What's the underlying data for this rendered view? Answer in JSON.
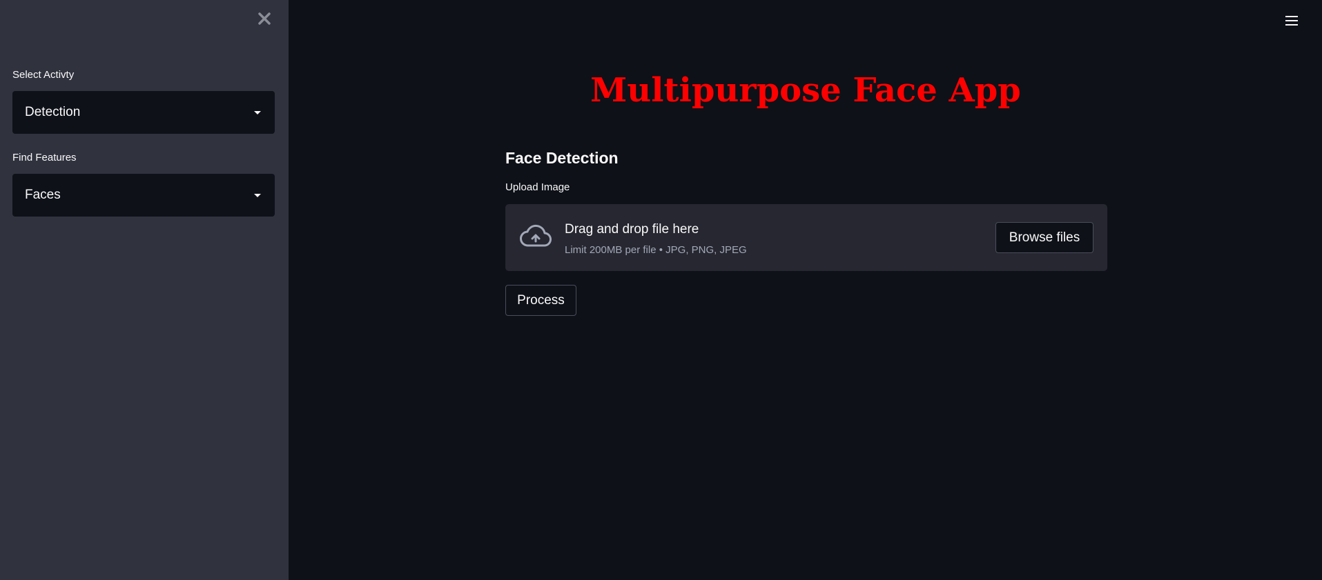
{
  "app": {
    "title": "Multipurpose Face App"
  },
  "sidebar": {
    "close_icon": "close-icon",
    "activity": {
      "label": "Select Activty",
      "value": "Detection"
    },
    "features": {
      "label": "Find Features",
      "value": "Faces"
    }
  },
  "main": {
    "menu_icon": "hamburger-menu-icon",
    "section_title": "Face Detection",
    "uploader": {
      "label": "Upload Image",
      "prompt": "Drag and drop file here",
      "limits": "Limit 200MB per file • JPG, PNG, JPEG",
      "browse_label": "Browse files",
      "icon": "cloud-upload-icon"
    },
    "process_label": "Process"
  },
  "colors": {
    "sidebar_bg": "#30323e",
    "main_bg": "#0e1118",
    "title": "#ff0000",
    "dropzone_bg": "#262730"
  }
}
